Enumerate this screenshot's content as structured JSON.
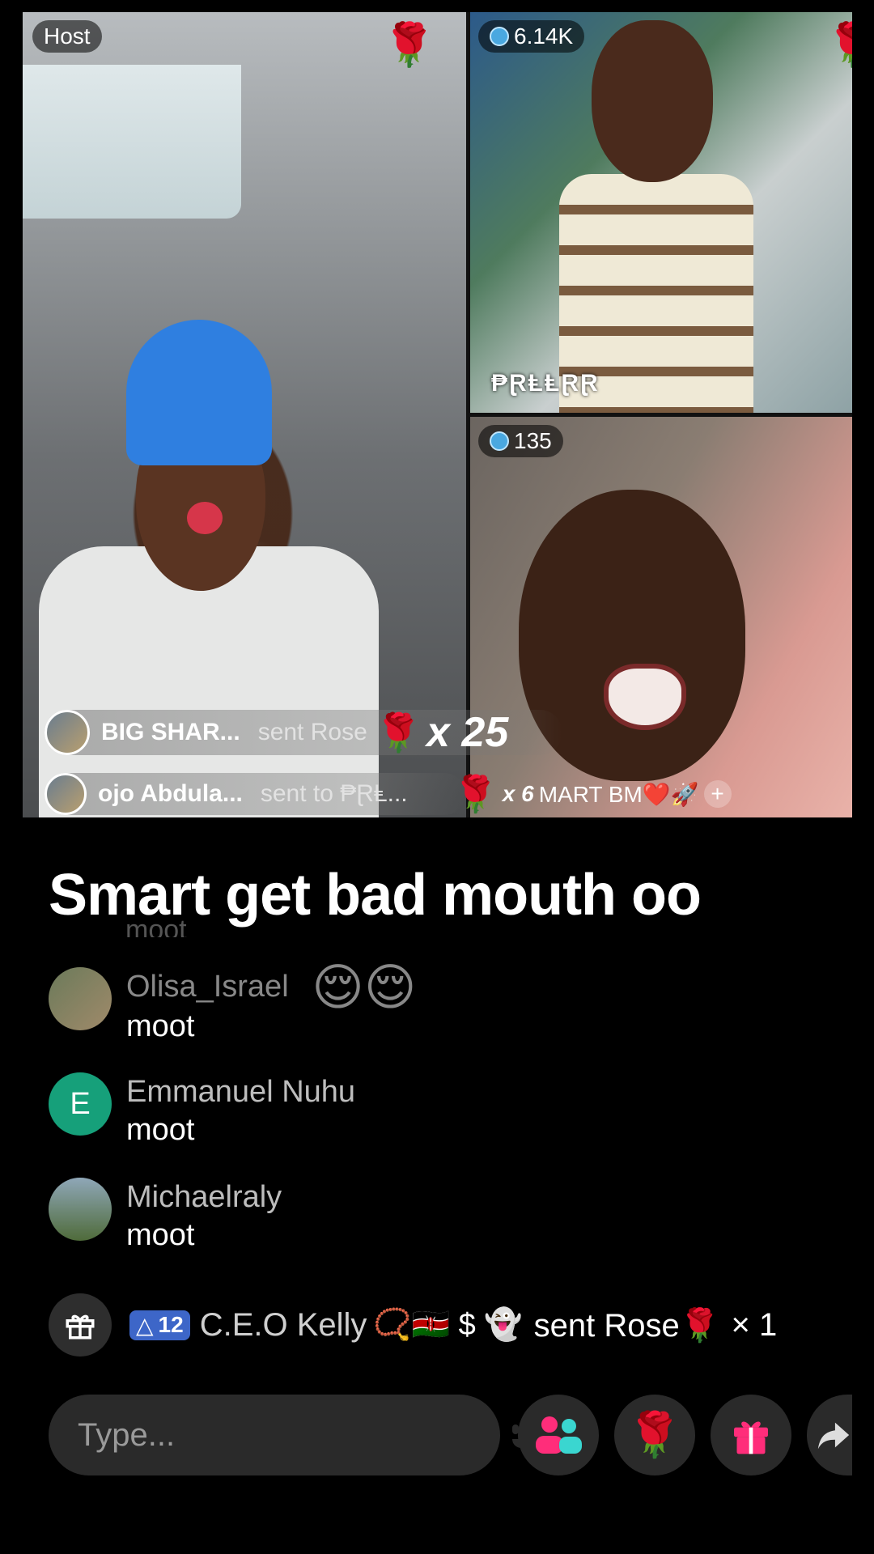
{
  "tiles": {
    "host": {
      "badge": "Host"
    },
    "guest1": {
      "viewers": "6.14K",
      "name": "₱ⱤⱠⱠⱤⱤ"
    },
    "guest2": {
      "viewers": "135"
    }
  },
  "gift_banners": [
    {
      "user": "BIG SHAR...",
      "action": "sent Rose",
      "count": "x 25"
    },
    {
      "user": "ojo Abdula...",
      "action": "sent to ₱ⱤⱠ...",
      "count": "x 6"
    }
  ],
  "participants_label": "MART BM❤️🚀",
  "headline": "Smart get bad mouth oo",
  "ghost_comment": "moot",
  "comments": [
    {
      "user": "Olisa_Israel",
      "emojis": "😌😌",
      "text": "moot"
    },
    {
      "user": "Emmanuel Nuhu",
      "initial": "E",
      "text": "moot"
    },
    {
      "user": "Michaelraly",
      "text": "moot"
    }
  ],
  "gift_event": {
    "level": "12",
    "user": "C.E.O Kelly",
    "decor": "📿🇰🇪 $ 👻",
    "action": "sent Rose🌹",
    "count": "× 1"
  },
  "input": {
    "placeholder": "Type..."
  },
  "colors": {
    "accent_pink": "#ff2d7a",
    "level_badge": "#3d66c8",
    "avatar_green": "#16a07a"
  }
}
